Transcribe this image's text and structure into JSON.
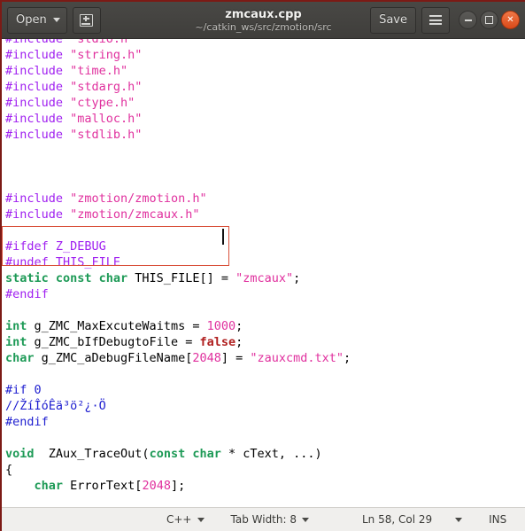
{
  "window": {
    "title": "zmcaux.cpp",
    "subtitle": "~/catkin_ws/src/zmotion/src",
    "open_label": "Open",
    "save_label": "Save",
    "icons": {
      "save_as": "save-as-icon",
      "menu": "hamburger-menu-icon",
      "minimize": "minimize-icon",
      "maximize": "maximize-icon",
      "close": "close-icon",
      "open_caret": "chevron-down-icon"
    }
  },
  "editor": {
    "language": "C++",
    "lines": [
      [
        {
          "t": "#include ",
          "c": "pp"
        },
        {
          "t": "\"stdio.h\"",
          "c": "str"
        }
      ],
      [
        {
          "t": "#include ",
          "c": "pp"
        },
        {
          "t": "\"string.h\"",
          "c": "str"
        }
      ],
      [
        {
          "t": "#include ",
          "c": "pp"
        },
        {
          "t": "\"time.h\"",
          "c": "str"
        }
      ],
      [
        {
          "t": "#include ",
          "c": "pp"
        },
        {
          "t": "\"stdarg.h\"",
          "c": "str"
        }
      ],
      [
        {
          "t": "#include ",
          "c": "pp"
        },
        {
          "t": "\"ctype.h\"",
          "c": "str"
        }
      ],
      [
        {
          "t": "#include ",
          "c": "pp"
        },
        {
          "t": "\"malloc.h\"",
          "c": "str"
        }
      ],
      [
        {
          "t": "#include ",
          "c": "pp"
        },
        {
          "t": "\"stdlib.h\"",
          "c": "str"
        }
      ],
      [],
      [],
      [],
      [
        {
          "t": "#include ",
          "c": "pp"
        },
        {
          "t": "\"zmotion/zmotion.h\"",
          "c": "str"
        }
      ],
      [
        {
          "t": "#include ",
          "c": "pp"
        },
        {
          "t": "\"zmotion/zmcaux.h\"",
          "c": "str"
        }
      ],
      [],
      [
        {
          "t": "#ifdef Z_DEBUG",
          "c": "pp"
        }
      ],
      [
        {
          "t": "#undef THIS_FILE",
          "c": "pp"
        }
      ],
      [
        {
          "t": "static const char",
          "c": "kw"
        },
        {
          "t": " THIS_FILE[] = ",
          "c": "plain"
        },
        {
          "t": "\"zmcaux\"",
          "c": "str"
        },
        {
          "t": ";",
          "c": "plain"
        }
      ],
      [
        {
          "t": "#endif",
          "c": "pp"
        }
      ],
      [],
      [
        {
          "t": "int",
          "c": "kw"
        },
        {
          "t": " g_ZMC_MaxExcuteWaitms = ",
          "c": "plain"
        },
        {
          "t": "1000",
          "c": "num"
        },
        {
          "t": ";",
          "c": "plain"
        }
      ],
      [
        {
          "t": "int",
          "c": "kw"
        },
        {
          "t": " g_ZMC_bIfDebugtoFile = ",
          "c": "plain"
        },
        {
          "t": "false",
          "c": "bool"
        },
        {
          "t": ";",
          "c": "plain"
        }
      ],
      [
        {
          "t": "char",
          "c": "kw"
        },
        {
          "t": " g_ZMC_aDebugFileName[",
          "c": "plain"
        },
        {
          "t": "2048",
          "c": "num"
        },
        {
          "t": "] = ",
          "c": "plain"
        },
        {
          "t": "\"zauxcmd.txt\"",
          "c": "str"
        },
        {
          "t": ";",
          "c": "plain"
        }
      ],
      [],
      [
        {
          "t": "#if 0",
          "c": "cmt"
        }
      ],
      [
        {
          "t": "//ŽíÎóÊä³ö²¿·Ö",
          "c": "cmt"
        }
      ],
      [
        {
          "t": "#endif",
          "c": "cmt"
        }
      ],
      [],
      [
        {
          "t": "void",
          "c": "kw"
        },
        {
          "t": "  ZAux_TraceOut(",
          "c": "plain"
        },
        {
          "t": "const char",
          "c": "kw"
        },
        {
          "t": " * cText, ...)",
          "c": "plain"
        }
      ],
      [
        {
          "t": "{",
          "c": "plain"
        }
      ],
      [
        {
          "t": "    ",
          "c": "plain"
        },
        {
          "t": "char",
          "c": "kw"
        },
        {
          "t": " ErrorText[",
          "c": "plain"
        },
        {
          "t": "2048",
          "c": "num"
        },
        {
          "t": "];",
          "c": "plain"
        }
      ]
    ]
  },
  "statusbar": {
    "language": "C++",
    "tab_width": "Tab Width: 8",
    "position": "Ln 58, Col 29",
    "insert_mode": "INS"
  },
  "colors": {
    "titlebar_bg": "#494845",
    "window_border": "#7c1a15",
    "highlight_box": "#d9503a",
    "preprocessor": "#a020f0",
    "string": "#e0309e",
    "keyword": "#1d9a56",
    "comment": "#2020d0",
    "boolean": "#b02020",
    "close_button": "#e55320"
  }
}
